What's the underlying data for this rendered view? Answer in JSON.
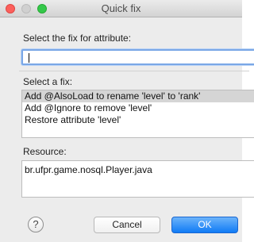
{
  "window": {
    "title": "Quick fix"
  },
  "attribute": {
    "label": "Select the fix for attribute:",
    "value": ""
  },
  "fixes": {
    "label": "Select a fix:",
    "items": [
      {
        "label": "Add @AlsoLoad to rename 'level' to 'rank'",
        "selected": true
      },
      {
        "label": "Add @Ignore to remove 'level'",
        "selected": false
      },
      {
        "label": "Restore attribute 'level'",
        "selected": false
      }
    ]
  },
  "resource": {
    "label": "Resource:",
    "items": [
      "br.ufpr.game.nosql.Player.java"
    ]
  },
  "buttons": {
    "help": "?",
    "cancel": "Cancel",
    "ok": "OK"
  }
}
